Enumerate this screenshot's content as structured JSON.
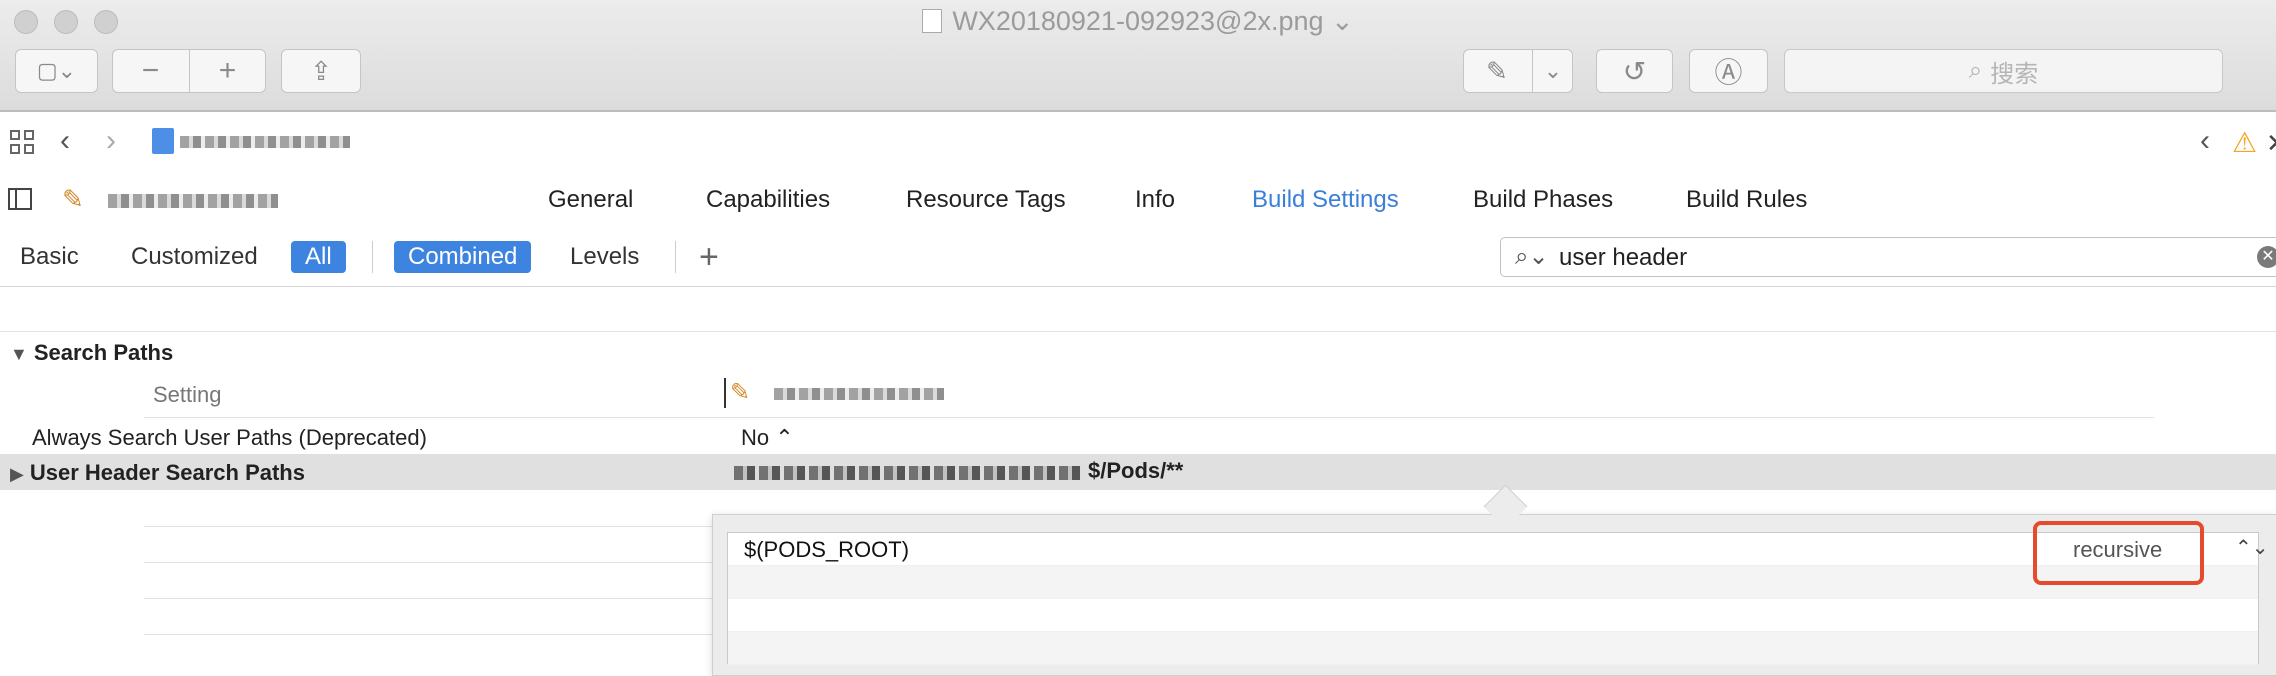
{
  "window": {
    "title": "WX20180921-092923@2x.png",
    "title_chevron": "⌄"
  },
  "preview_toolbar": {
    "sidebar_menu_glyph": "▢⌄",
    "zoom_out_glyph": "−",
    "zoom_in_glyph": "+",
    "share_glyph": "⇪",
    "markup_glyph": "✎",
    "markup_menu_glyph": "⌄",
    "rotate_glyph": "↺",
    "annotate_glyph": "Ⓐ",
    "search_placeholder": "搜索",
    "search_icon_glyph": "⌕"
  },
  "jump_bar": {
    "back_glyph": "‹",
    "forward_glyph": "›",
    "issues_prev_glyph": "‹",
    "warning_glyph": "⚠",
    "close_glyph": "✕"
  },
  "tabs": [
    {
      "label": "General"
    },
    {
      "label": "Capabilities"
    },
    {
      "label": "Resource Tags"
    },
    {
      "label": "Info"
    },
    {
      "label": "Build Settings"
    },
    {
      "label": "Build Phases"
    },
    {
      "label": "Build Rules"
    }
  ],
  "filters": {
    "basic": "Basic",
    "customized": "Customized",
    "all": "All",
    "combined": "Combined",
    "levels": "Levels",
    "add": "+",
    "search_value": "user header",
    "search_icon_glyph": "⌕⌄",
    "clear_glyph": "✕"
  },
  "settings": {
    "section_title": "Search Paths",
    "section_triangle": "▼",
    "column_setting": "Setting",
    "rows": [
      {
        "label": "Always Search User Paths (Deprecated)",
        "value": "No ⌃"
      },
      {
        "label": "User Header Search Paths",
        "value": "$/Pods/**",
        "triangle": "▶"
      }
    ]
  },
  "popover": {
    "paths": [
      {
        "value": "$(PODS_ROOT)",
        "mode": "recursive",
        "stepper": "⌃⌄"
      }
    ]
  },
  "colors": {
    "accent": "#3d83e0",
    "highlight": "#e54a2e",
    "active_tab": "#3b7fd8",
    "warning": "#f5a623"
  }
}
